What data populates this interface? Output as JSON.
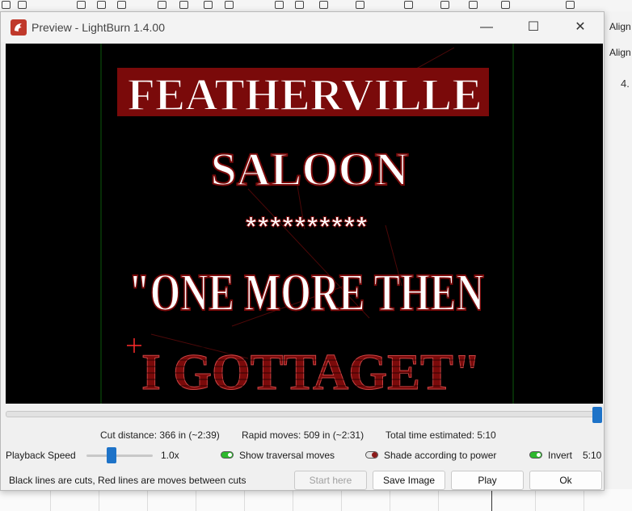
{
  "window": {
    "title": "Preview - LightBurn 1.4.00",
    "minimize_glyph": "—",
    "maximize_glyph": "☐",
    "close_glyph": "✕"
  },
  "background_app": {
    "align_label_1": "Align",
    "align_label_2": "Align",
    "side_value": "4."
  },
  "preview": {
    "design_lines": [
      "FEATHERVILLE",
      "SALOON",
      "**********",
      "\"ONE MORE THEN",
      "I GOTTAGET\""
    ],
    "colors": {
      "cut": "#ffffff",
      "shade": "#7a0a0a",
      "canvas": "#000000",
      "marker": "#ff2a2a"
    },
    "timeline_position": 1.0
  },
  "stats": {
    "cut_distance": "Cut distance: 366 in (~2:39)",
    "rapid_moves": "Rapid moves: 509 in (~2:31)",
    "total_time": "Total time estimated: 5:10"
  },
  "playback": {
    "label": "Playback Speed",
    "speed_value": "1.0x",
    "speed_level": 0.33,
    "time_value": "5:10"
  },
  "options": {
    "show_traversal": {
      "label": "Show traversal moves",
      "on": true
    },
    "shade_power": {
      "label": "Shade according to power",
      "on": true
    },
    "invert": {
      "label": "Invert",
      "on": true
    }
  },
  "footer": {
    "note": "Black lines are cuts, Red lines are moves between cuts",
    "start_here": "Start here",
    "save_image": "Save Image",
    "play": "Play",
    "ok": "Ok"
  }
}
